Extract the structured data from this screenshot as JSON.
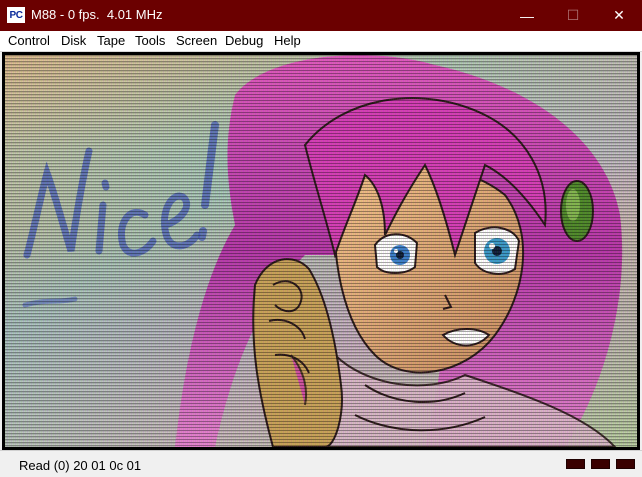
{
  "window": {
    "icon_text": "PC",
    "title": "M88 - 0 fps.  4.01 MHz",
    "minimize_glyph": "—",
    "maximize_glyph": "☐",
    "close_glyph": "✕"
  },
  "menu": {
    "items": [
      "Control",
      "Disk",
      "Tape",
      "Tools",
      "Screen",
      "Debug",
      "Help"
    ]
  },
  "screen": {
    "handwritten_text": "Nice!",
    "description_icon": "anime-girl-emulator-screen"
  },
  "status": {
    "text": "Read (0) 20 01 0c 01",
    "indicator_color": "#3a0000"
  }
}
